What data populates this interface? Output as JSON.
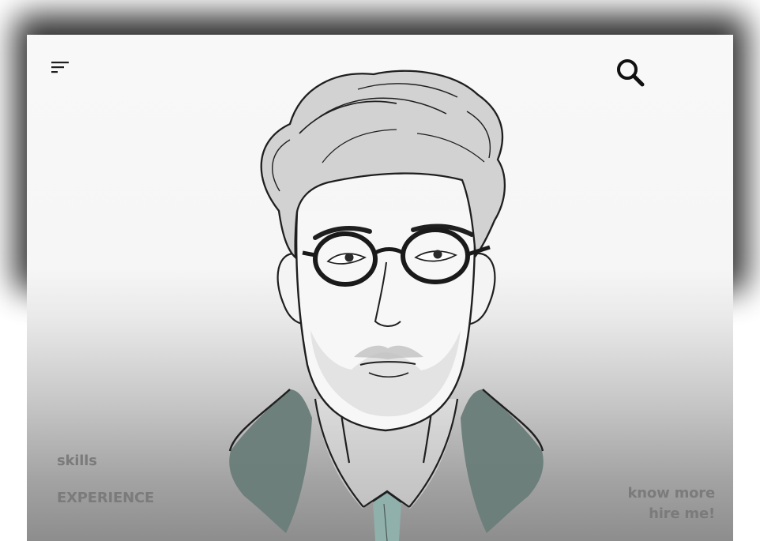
{
  "nav": {
    "skills": "skills",
    "experience": "EXPERIENCE",
    "know_more": "know more",
    "hire_me": "hire me!"
  },
  "icons": {
    "menu": "menu-icon",
    "search": "search-icon",
    "portrait": "portrait-illustration"
  },
  "colors": {
    "background": "#ffffff",
    "card_top": "#f8f8f8",
    "card_bottom": "#8d8d8d",
    "link_text": "#7b7b7b",
    "suit_accent": "#6b7e7a",
    "tie_accent": "#8fb0ab",
    "line_art": "#1f1f1f",
    "hair_tone": "#cfcfcf"
  }
}
